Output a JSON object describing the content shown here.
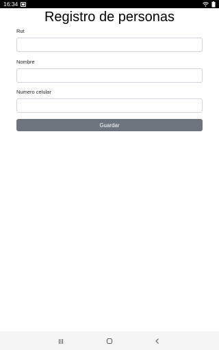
{
  "status_bar": {
    "time": "16:34",
    "icons": [
      "notification-icon",
      "wifi-icon",
      "battery-icon"
    ]
  },
  "page": {
    "title": "Registro de personas"
  },
  "form": {
    "fields": [
      {
        "label": "Rut",
        "value": "",
        "placeholder": ""
      },
      {
        "label": "Nombre",
        "value": "",
        "placeholder": ""
      },
      {
        "label": "Numero celular",
        "value": "",
        "placeholder": ""
      }
    ],
    "submit_label": "Guardar"
  },
  "nav_bar": {
    "buttons": [
      "recent-apps-icon",
      "home-icon",
      "back-icon"
    ]
  },
  "colors": {
    "button_bg": "#6c757d",
    "input_border": "#ced4da",
    "status_bar_bg": "#000000",
    "nav_bar_bg": "#f5f5f5"
  }
}
